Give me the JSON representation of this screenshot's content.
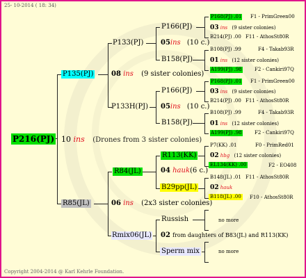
{
  "header": {
    "date": "25- 10-2014 ( 18: 34)"
  },
  "footer": {
    "copyright": "Copyright 2004-2014 @ Karl Kehrle Foundation."
  },
  "tree": {
    "root": {
      "label": "P216(PJ)",
      "gen": "10",
      "ins": "ins",
      "note": "(Drones from 3 sister colonies)"
    },
    "mother": {
      "label": "P135(PJ)",
      "gen": "08",
      "ins": "ins",
      "note": "(9 sister colonies)"
    },
    "father": {
      "label": "R85(JL)",
      "gen": "06",
      "ins": "ins",
      "note": "(2x3 sister colonies)"
    },
    "p133": {
      "label": "P133(PJ)",
      "gen": "05",
      "ins": "ins",
      "note": "(10 c.)"
    },
    "p133h": {
      "label": "P133H(PJ)",
      "gen": "05",
      "ins": "ins",
      "note": "(10 c.)"
    },
    "p166a": {
      "label": "P166(PJ)"
    },
    "b158a": {
      "label": "B158(PJ)"
    },
    "p166b": {
      "label": "P166(PJ)"
    },
    "b158b": {
      "label": "B158(PJ)"
    },
    "r84": {
      "label": "R84(JL)",
      "gen": "04",
      "ins": "hauk",
      "note": "(6 c.)"
    },
    "rmix": {
      "label": "Rmix06(JL)",
      "gen": "02",
      "note": "from daughters of B83(JL) and R113(KK)"
    },
    "r113": {
      "label": "R113(KK)"
    },
    "b29": {
      "label": "B29pp(JL)"
    },
    "russish": {
      "label": "Russish"
    },
    "spermmix": {
      "label": "Sperm mix"
    },
    "g1": {
      "top": "P168(PJ) .01",
      "top_right": "F1 - PrimGreen00",
      "gen": "03",
      "ins": "ins",
      "note": "(9 sister colonies)",
      "bottom": "B214(PJ) .00",
      "bottom_right": "F11 - AthosSt80R"
    },
    "g2": {
      "top": "B108(PJ) .99",
      "top_right": "F4 - Takab93R",
      "gen": "01",
      "ins": "ins",
      "note": "(12 sister colonies)",
      "bottom": "A199(PJ) .98",
      "bottom_right": "F2 - Cankiri97Q"
    },
    "g3": {
      "top": "P168(PJ) .01",
      "top_right": "F1 - PrimGreen00",
      "gen": "03",
      "ins": "ins",
      "note": "(9 sister colonies)",
      "bottom": "B214(PJ) .00",
      "bottom_right": "F11 - AthosSt80R"
    },
    "g4": {
      "top": "B108(PJ) .99",
      "top_right": "F4 - Takab93R",
      "gen": "01",
      "ins": "ins",
      "note": "(12 sister colonies)",
      "bottom": "A199(PJ) .98",
      "bottom_right": "F2 - Cankiri97Q"
    },
    "g5": {
      "top": "P7(KK) .01",
      "top_right": "F0 - PrimRed01",
      "gen": "02",
      "ins": "hbg",
      "note": "(12 sister colonies)",
      "bottom": "EL134(KK) .00",
      "bottom_right": "F2 - EO408"
    },
    "g6": {
      "top": "B148(JL) .01",
      "top_right": "F11 - AthosSt80R",
      "gen": "02",
      "ins": "hauk",
      "note": "",
      "bottom": "B118(JL) .00",
      "bottom_right": "F10 - AthosSt80R"
    },
    "g7": {
      "more": "no more"
    },
    "g8": {
      "more": "no more"
    }
  },
  "colors": {
    "border": "#e0148c",
    "background": "#fffcd6",
    "green": "#00e000",
    "cyan": "#00ffff",
    "gray": "#c0c0c0",
    "yellow": "#ffff00",
    "lavender": "#e8e8ff",
    "ins_red": "#e0101f"
  }
}
